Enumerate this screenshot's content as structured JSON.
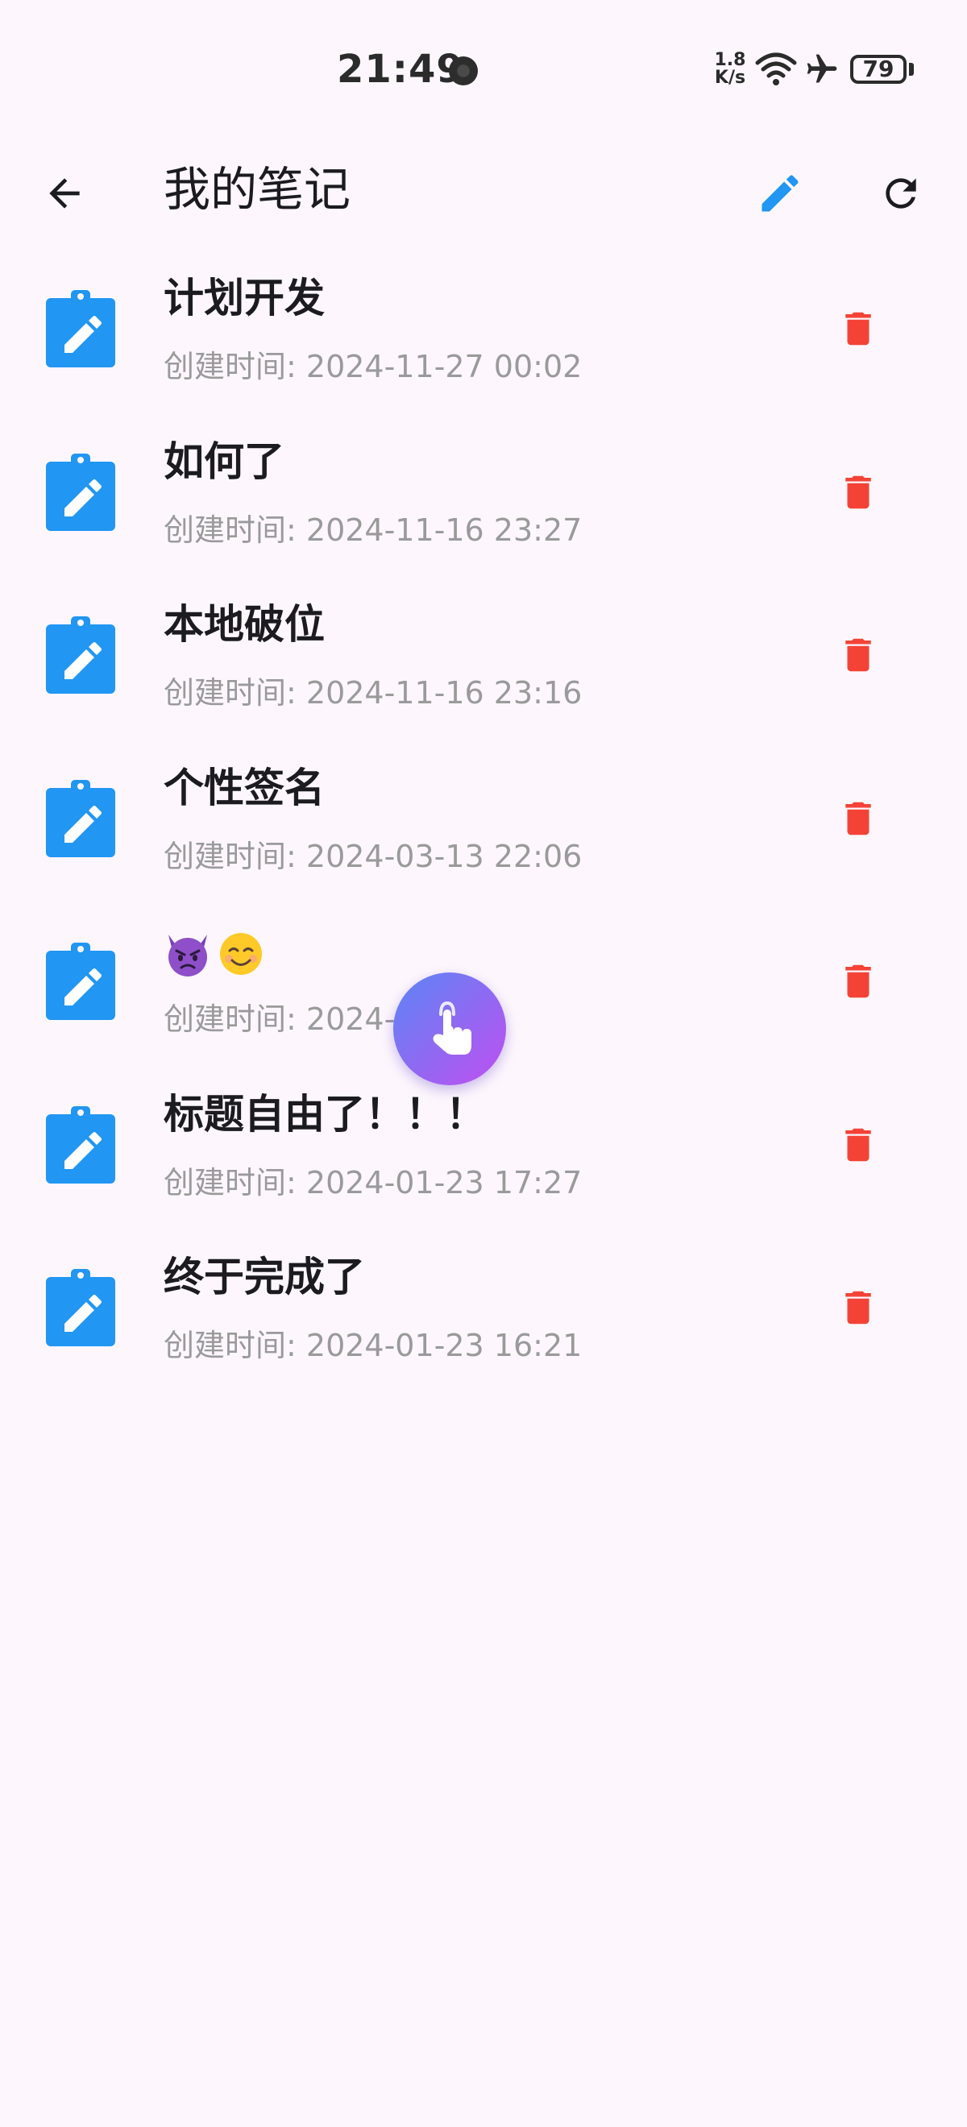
{
  "status_bar": {
    "time": "21:49",
    "net_speed_value": "1.8",
    "net_speed_unit": "K/s",
    "battery": "79",
    "icons": [
      "camera-dot-icon",
      "wifi-icon",
      "airplane-mode-icon",
      "battery-icon"
    ]
  },
  "app_bar": {
    "title": "我的笔记",
    "back_icon": "arrow-back-icon",
    "edit_icon": "pencil-icon",
    "refresh_icon": "refresh-icon"
  },
  "notes": [
    {
      "title": "计划开发",
      "time_label": "创建时间: ",
      "time": "2024-11-27 00:02"
    },
    {
      "title": "如何了",
      "time_label": "创建时间: ",
      "time": "2024-11-16 23:27"
    },
    {
      "title": "本地破位",
      "time_label": "创建时间: ",
      "time": "2024-11-16 23:16"
    },
    {
      "title": "个性签名",
      "time_label": "创建时间: ",
      "time": "2024-03-13 22:06"
    },
    {
      "title": "",
      "title_emojis": [
        "angry-devil-emoji",
        "smiling-face-emoji"
      ],
      "time_label": "创建时间: ",
      "time": "2024-…3:31"
    },
    {
      "title": "标题自由了！！！",
      "time_label": "创建时间: ",
      "time": "2024-01-23 17:27"
    },
    {
      "title": "终于完成了",
      "time_label": "创建时间: ",
      "time": "2024-01-23 16:21"
    }
  ],
  "colors": {
    "background": "#fdf7fd",
    "note_icon": "#2196f3",
    "delete_icon": "#f44336",
    "edit_icon": "#2196f3",
    "time_text": "#9a9a9a",
    "floating_gradient_start": "#5b86f5",
    "floating_gradient_end": "#c04ff0"
  },
  "floating_button": {
    "icon": "touch-hand-icon"
  }
}
